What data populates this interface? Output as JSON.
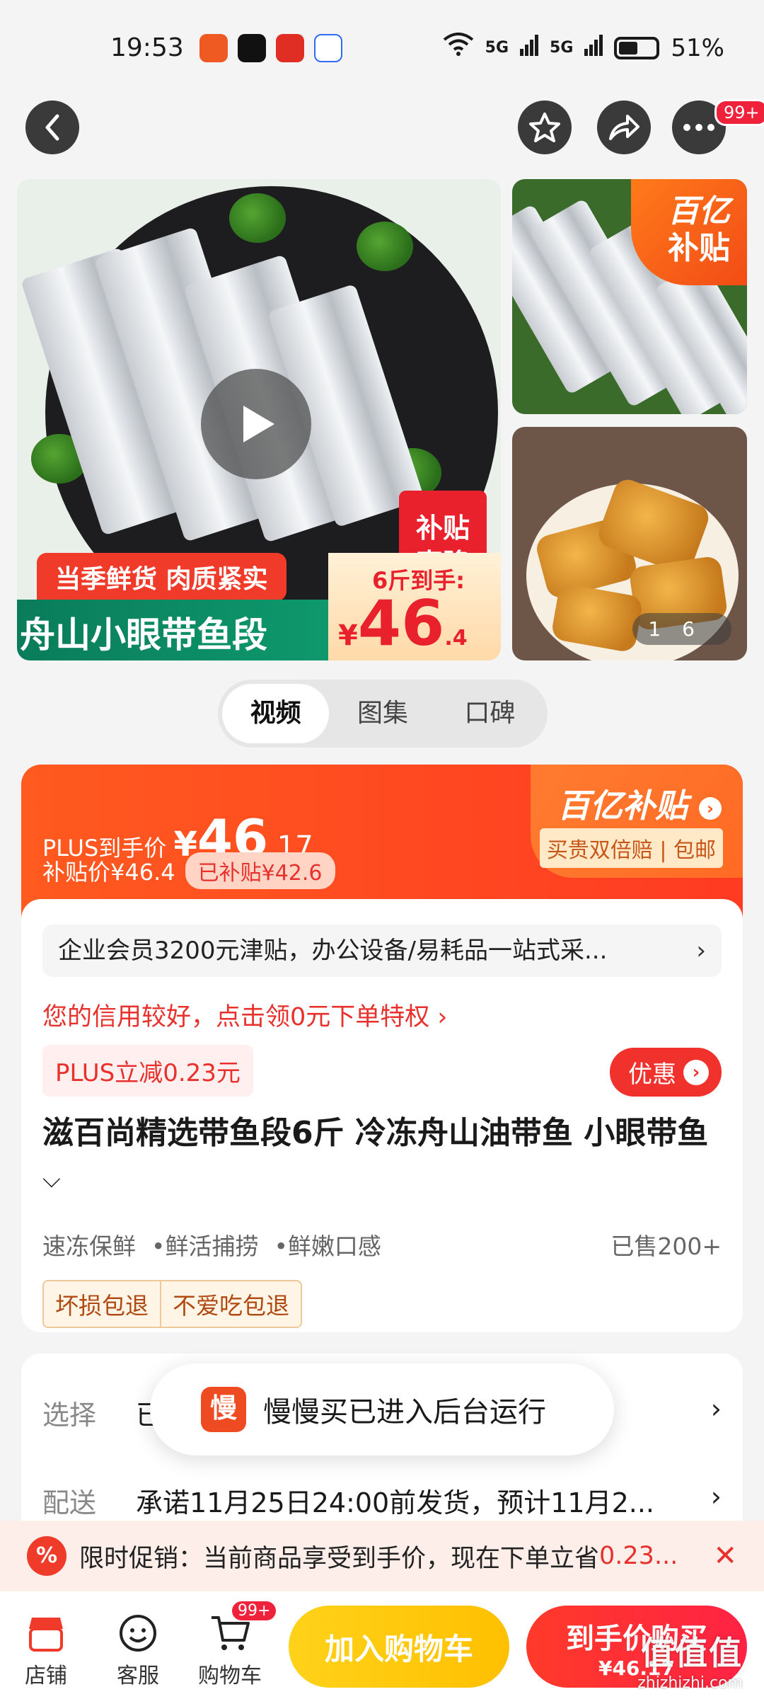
{
  "status_bar": {
    "time": "19:53",
    "network1": "5G",
    "network2": "5G",
    "battery": "51%"
  },
  "gallery": {
    "tag_subsidy_line1": "补贴",
    "tag_subsidy_line2": "直降",
    "banner_top": "当季鲜货 肉质紧实",
    "banner_main": "舟山小眼带鱼段",
    "price_label": "6斤到手:",
    "price_symbol": "¥",
    "price_int": "46",
    "price_dec": ".4",
    "yiyi_line1": "百亿",
    "yiyi_line2": "补贴",
    "counter_current": "1",
    "counter_total": "6"
  },
  "tabs": [
    {
      "label": "视频",
      "active": true
    },
    {
      "label": "图集",
      "active": false
    },
    {
      "label": "口碑",
      "active": false
    }
  ],
  "price_header": {
    "plus_label": "PLUS到手价",
    "symbol": "¥",
    "price_int": "46",
    "price_dec": ".17",
    "subsidy_price": "补贴价¥46.4",
    "subsidized_chip": "已补贴¥42.6",
    "brand": "百亿补贴",
    "guarantee": "买贵双倍赔 | 包邮"
  },
  "info": {
    "notice": "企业会员3200元津贴，办公设备/易耗品一站式采...",
    "credit": "您的信用较好，点击领0元下单特权 ›",
    "plus_tag": "PLUS立减0.23元",
    "youhui": "优惠",
    "title": "滋百尚精选带鱼段6斤 冷冻舟山油带鱼 小眼带鱼",
    "features": [
      "速冻保鲜",
      "•鲜活捕捞",
      "•鲜嫩口感"
    ],
    "sold": "已售200+",
    "guarantees": [
      "坏损包退",
      "不爱吃包退"
    ]
  },
  "options": {
    "select_key": "选择",
    "select_value": "已选 6斤",
    "ship_key": "配送",
    "ship_value": "承诺11月25日24:00前发货，预计11月2..."
  },
  "toast": {
    "logo": "慢",
    "text": "慢慢买已进入后台运行"
  },
  "promo": {
    "icon": "%",
    "text": "限时促销：当前商品享受到手价，现在下单立省",
    "amount": "0.23..."
  },
  "bottom_bar": {
    "store": "店铺",
    "service": "客服",
    "cart": "购物车",
    "cart_badge": "99+",
    "add_to_cart": "加入购物车",
    "buy_label": "到手价购买",
    "buy_price": "¥46.17"
  },
  "nav": {
    "more_badge": "99+"
  },
  "watermark": {
    "main": "值值值",
    "sub": "zhizhizhi.com"
  }
}
